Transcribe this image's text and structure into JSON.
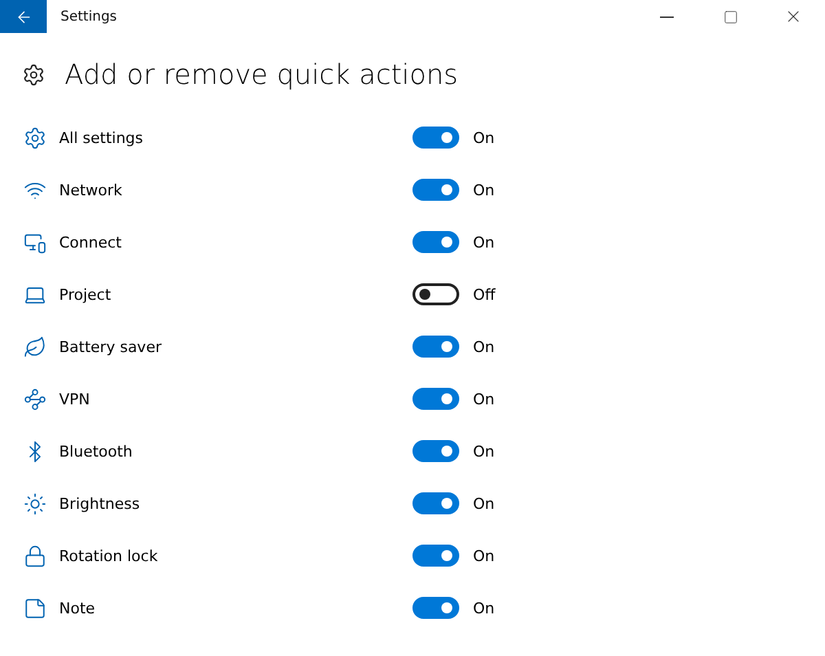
{
  "window": {
    "title": "Settings"
  },
  "page": {
    "heading": "Add or remove quick actions"
  },
  "actions": [
    {
      "label": "All settings",
      "on": true,
      "state_text": "On"
    },
    {
      "label": "Network",
      "on": true,
      "state_text": "On"
    },
    {
      "label": "Connect",
      "on": true,
      "state_text": "On"
    },
    {
      "label": "Project",
      "on": false,
      "state_text": "Off"
    },
    {
      "label": "Battery saver",
      "on": true,
      "state_text": "On"
    },
    {
      "label": "VPN",
      "on": true,
      "state_text": "On"
    },
    {
      "label": "Bluetooth",
      "on": true,
      "state_text": "On"
    },
    {
      "label": "Brightness",
      "on": true,
      "state_text": "On"
    },
    {
      "label": "Rotation lock",
      "on": true,
      "state_text": "On"
    },
    {
      "label": "Note",
      "on": true,
      "state_text": "On"
    }
  ]
}
